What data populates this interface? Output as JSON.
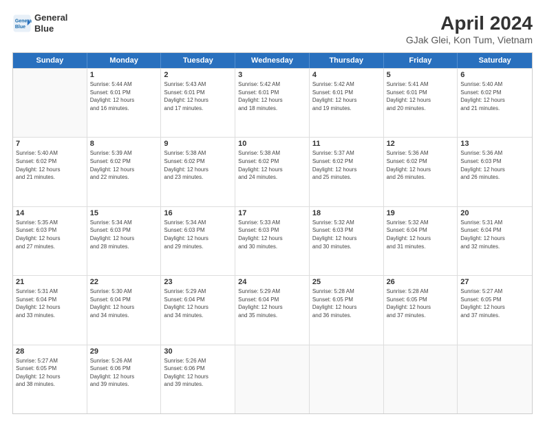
{
  "header": {
    "logo_line1": "General",
    "logo_line2": "Blue",
    "main_title": "April 2024",
    "subtitle": "GJak Glei, Kon Tum, Vietnam"
  },
  "days_of_week": [
    "Sunday",
    "Monday",
    "Tuesday",
    "Wednesday",
    "Thursday",
    "Friday",
    "Saturday"
  ],
  "weeks": [
    [
      {
        "day": "",
        "info": ""
      },
      {
        "day": "1",
        "info": "Sunrise: 5:44 AM\nSunset: 6:01 PM\nDaylight: 12 hours\nand 16 minutes."
      },
      {
        "day": "2",
        "info": "Sunrise: 5:43 AM\nSunset: 6:01 PM\nDaylight: 12 hours\nand 17 minutes."
      },
      {
        "day": "3",
        "info": "Sunrise: 5:42 AM\nSunset: 6:01 PM\nDaylight: 12 hours\nand 18 minutes."
      },
      {
        "day": "4",
        "info": "Sunrise: 5:42 AM\nSunset: 6:01 PM\nDaylight: 12 hours\nand 19 minutes."
      },
      {
        "day": "5",
        "info": "Sunrise: 5:41 AM\nSunset: 6:01 PM\nDaylight: 12 hours\nand 20 minutes."
      },
      {
        "day": "6",
        "info": "Sunrise: 5:40 AM\nSunset: 6:02 PM\nDaylight: 12 hours\nand 21 minutes."
      }
    ],
    [
      {
        "day": "7",
        "info": "Sunrise: 5:40 AM\nSunset: 6:02 PM\nDaylight: 12 hours\nand 21 minutes."
      },
      {
        "day": "8",
        "info": "Sunrise: 5:39 AM\nSunset: 6:02 PM\nDaylight: 12 hours\nand 22 minutes."
      },
      {
        "day": "9",
        "info": "Sunrise: 5:38 AM\nSunset: 6:02 PM\nDaylight: 12 hours\nand 23 minutes."
      },
      {
        "day": "10",
        "info": "Sunrise: 5:38 AM\nSunset: 6:02 PM\nDaylight: 12 hours\nand 24 minutes."
      },
      {
        "day": "11",
        "info": "Sunrise: 5:37 AM\nSunset: 6:02 PM\nDaylight: 12 hours\nand 25 minutes."
      },
      {
        "day": "12",
        "info": "Sunrise: 5:36 AM\nSunset: 6:02 PM\nDaylight: 12 hours\nand 26 minutes."
      },
      {
        "day": "13",
        "info": "Sunrise: 5:36 AM\nSunset: 6:03 PM\nDaylight: 12 hours\nand 26 minutes."
      }
    ],
    [
      {
        "day": "14",
        "info": "Sunrise: 5:35 AM\nSunset: 6:03 PM\nDaylight: 12 hours\nand 27 minutes."
      },
      {
        "day": "15",
        "info": "Sunrise: 5:34 AM\nSunset: 6:03 PM\nDaylight: 12 hours\nand 28 minutes."
      },
      {
        "day": "16",
        "info": "Sunrise: 5:34 AM\nSunset: 6:03 PM\nDaylight: 12 hours\nand 29 minutes."
      },
      {
        "day": "17",
        "info": "Sunrise: 5:33 AM\nSunset: 6:03 PM\nDaylight: 12 hours\nand 30 minutes."
      },
      {
        "day": "18",
        "info": "Sunrise: 5:32 AM\nSunset: 6:03 PM\nDaylight: 12 hours\nand 30 minutes."
      },
      {
        "day": "19",
        "info": "Sunrise: 5:32 AM\nSunset: 6:04 PM\nDaylight: 12 hours\nand 31 minutes."
      },
      {
        "day": "20",
        "info": "Sunrise: 5:31 AM\nSunset: 6:04 PM\nDaylight: 12 hours\nand 32 minutes."
      }
    ],
    [
      {
        "day": "21",
        "info": "Sunrise: 5:31 AM\nSunset: 6:04 PM\nDaylight: 12 hours\nand 33 minutes."
      },
      {
        "day": "22",
        "info": "Sunrise: 5:30 AM\nSunset: 6:04 PM\nDaylight: 12 hours\nand 34 minutes."
      },
      {
        "day": "23",
        "info": "Sunrise: 5:29 AM\nSunset: 6:04 PM\nDaylight: 12 hours\nand 34 minutes."
      },
      {
        "day": "24",
        "info": "Sunrise: 5:29 AM\nSunset: 6:04 PM\nDaylight: 12 hours\nand 35 minutes."
      },
      {
        "day": "25",
        "info": "Sunrise: 5:28 AM\nSunset: 6:05 PM\nDaylight: 12 hours\nand 36 minutes."
      },
      {
        "day": "26",
        "info": "Sunrise: 5:28 AM\nSunset: 6:05 PM\nDaylight: 12 hours\nand 37 minutes."
      },
      {
        "day": "27",
        "info": "Sunrise: 5:27 AM\nSunset: 6:05 PM\nDaylight: 12 hours\nand 37 minutes."
      }
    ],
    [
      {
        "day": "28",
        "info": "Sunrise: 5:27 AM\nSunset: 6:05 PM\nDaylight: 12 hours\nand 38 minutes."
      },
      {
        "day": "29",
        "info": "Sunrise: 5:26 AM\nSunset: 6:06 PM\nDaylight: 12 hours\nand 39 minutes."
      },
      {
        "day": "30",
        "info": "Sunrise: 5:26 AM\nSunset: 6:06 PM\nDaylight: 12 hours\nand 39 minutes."
      },
      {
        "day": "",
        "info": ""
      },
      {
        "day": "",
        "info": ""
      },
      {
        "day": "",
        "info": ""
      },
      {
        "day": "",
        "info": ""
      }
    ]
  ]
}
